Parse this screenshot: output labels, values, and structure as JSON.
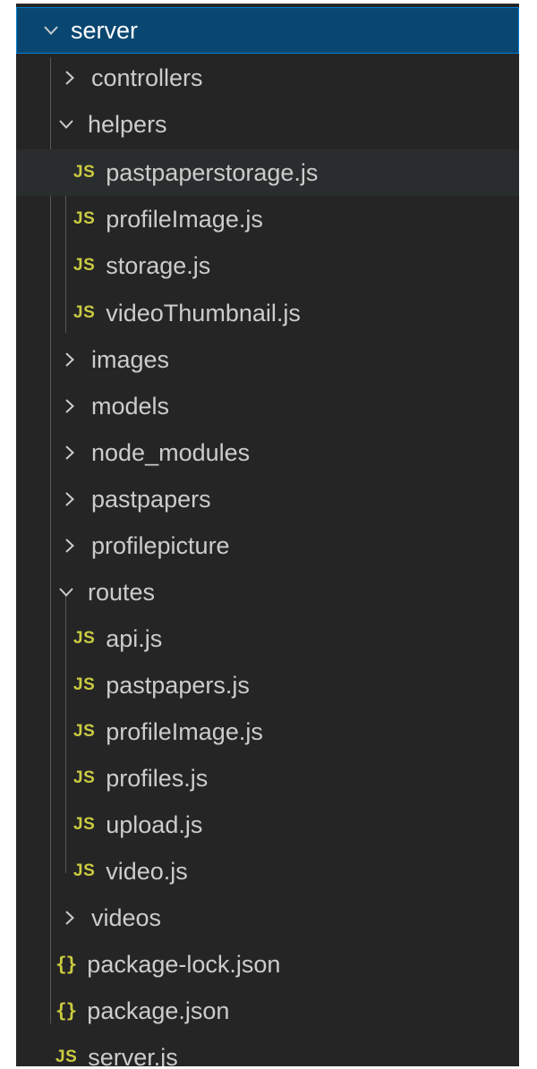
{
  "explorer": {
    "root": {
      "label": "server",
      "state": "expanded"
    },
    "controllers": {
      "label": "controllers",
      "state": "collapsed"
    },
    "helpers": {
      "label": "helpers",
      "state": "expanded",
      "files": [
        "pastpaperstorage.js",
        "profileImage.js",
        "storage.js",
        "videoThumbnail.js"
      ]
    },
    "images": {
      "label": "images",
      "state": "collapsed"
    },
    "models": {
      "label": "models",
      "state": "collapsed"
    },
    "node_modules": {
      "label": "node_modules",
      "state": "collapsed"
    },
    "pastpapers": {
      "label": "pastpapers",
      "state": "collapsed"
    },
    "profilepicture": {
      "label": "profilepicture",
      "state": "collapsed"
    },
    "routes": {
      "label": "routes",
      "state": "expanded",
      "files": [
        "api.js",
        "pastpapers.js",
        "profileImage.js",
        "profiles.js",
        "upload.js",
        "video.js"
      ]
    },
    "videos": {
      "label": "videos",
      "state": "collapsed"
    },
    "root_files": [
      "package-lock.json",
      "package.json",
      "server.js"
    ]
  },
  "icons": {
    "js_badge": "JS",
    "json_badge": "{}"
  },
  "colors": {
    "sidebar_bg": "#252526",
    "selected_bg": "#094771",
    "selected_border": "#007fd4",
    "hover_bg": "#2a2d2e",
    "text": "#cccccc",
    "js_icon": "#cbcb41",
    "indent_guide": "#585858"
  }
}
